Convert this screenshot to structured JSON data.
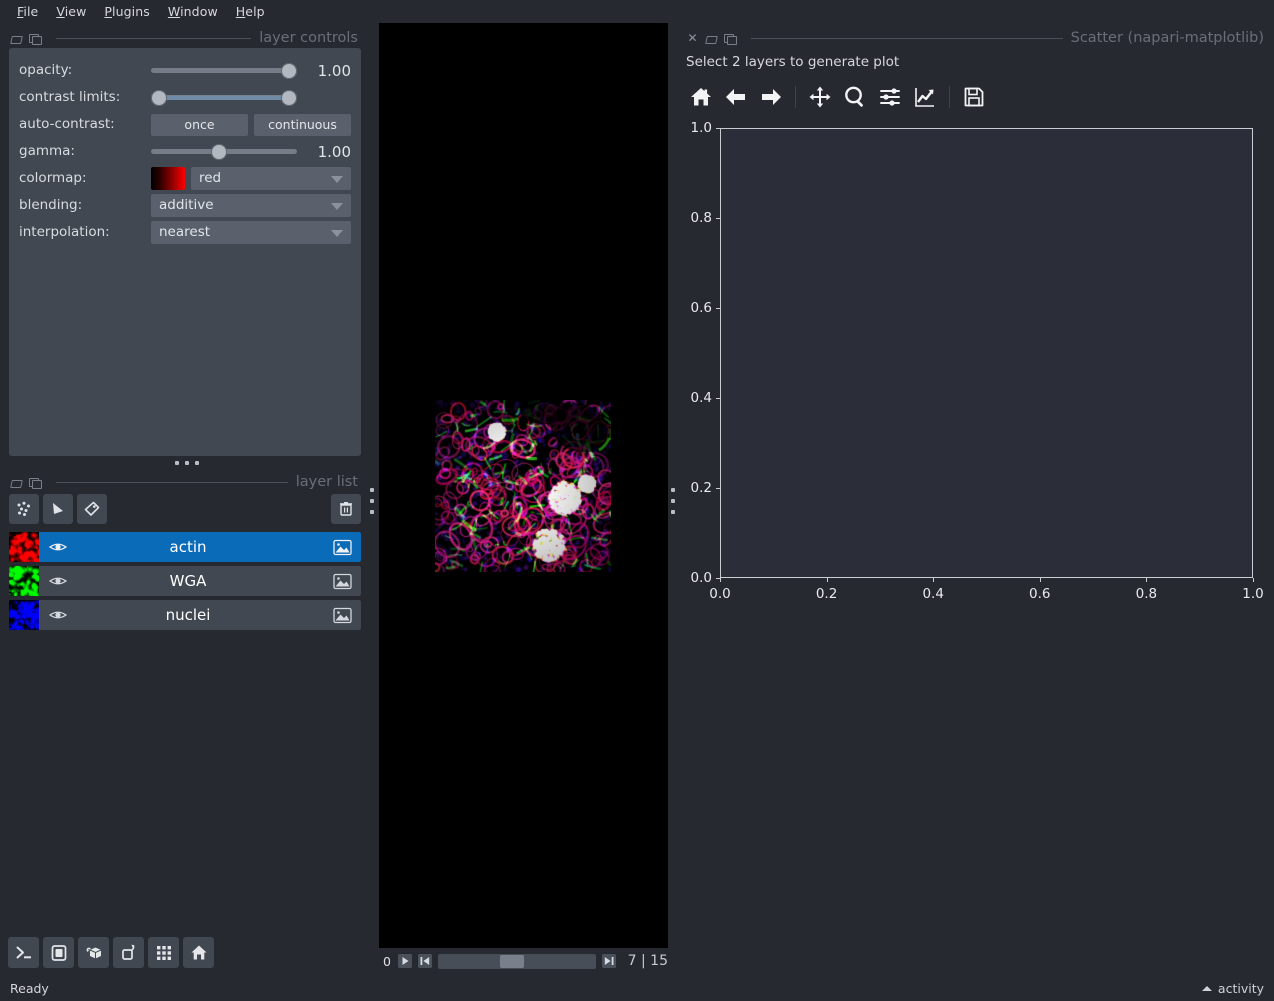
{
  "menubar": {
    "items": [
      {
        "label": "File",
        "mnemonic": "F"
      },
      {
        "label": "View",
        "mnemonic": "V"
      },
      {
        "label": "Plugins",
        "mnemonic": "P"
      },
      {
        "label": "Window",
        "mnemonic": "W"
      },
      {
        "label": "Help",
        "mnemonic": "H"
      }
    ]
  },
  "layer_controls": {
    "title": "layer controls",
    "opacity": {
      "label": "opacity:",
      "value": "1.00",
      "fraction": 1.0
    },
    "contrast_limits": {
      "label": "contrast limits:",
      "low_fraction": 0.0,
      "high_fraction": 1.0
    },
    "auto_contrast": {
      "label": "auto-contrast:",
      "once_label": "once",
      "continuous_label": "continuous"
    },
    "gamma": {
      "label": "gamma:",
      "value": "1.00",
      "fraction": 0.42
    },
    "colormap": {
      "label": "colormap:",
      "value": "red",
      "swatch_color": "#ff0000"
    },
    "blending": {
      "label": "blending:",
      "value": "additive"
    },
    "interpolation": {
      "label": "interpolation:",
      "value": "nearest"
    }
  },
  "layer_list": {
    "title": "layer list",
    "tools": [
      {
        "name": "new-points-layer",
        "tooltip": "New points layer"
      },
      {
        "name": "new-shapes-layer",
        "tooltip": "New shapes layer"
      },
      {
        "name": "new-labels-layer",
        "tooltip": "New labels layer"
      },
      {
        "name": "delete-layer",
        "tooltip": "Delete selected layers"
      }
    ],
    "layers": [
      {
        "name": "actin",
        "selected": true,
        "visible": true,
        "type": "image",
        "thumb_color": "#d01010"
      },
      {
        "name": "WGA",
        "selected": false,
        "visible": true,
        "type": "image",
        "thumb_color": "#10d010"
      },
      {
        "name": "nuclei",
        "selected": false,
        "visible": true,
        "type": "image",
        "thumb_color": "#2020e8"
      }
    ]
  },
  "viewer_buttons": [
    {
      "name": "console-button",
      "label": "Console"
    },
    {
      "name": "ndisplay-button",
      "label": "Toggle 2D/3D"
    },
    {
      "name": "roll-dims-button",
      "label": "Roll dimensions"
    },
    {
      "name": "transpose-dims-button",
      "label": "Transpose dimensions"
    },
    {
      "name": "grid-view-button",
      "label": "Grid view"
    },
    {
      "name": "reset-view-button",
      "label": "Reset view"
    }
  ],
  "dims": {
    "axis_label": "0",
    "play_label": "play",
    "first_label": "first frame",
    "last_label": "last frame",
    "current": "7",
    "separator": "|",
    "total": "15",
    "counter": "7 | 15",
    "handle_fraction": 0.47
  },
  "scatter_panel": {
    "title": "Scatter (napari-matplotlib)",
    "hint": "Select 2 layers to generate plot",
    "toolbar": [
      {
        "name": "home-icon",
        "label": "Reset original view"
      },
      {
        "name": "back-arrow-icon",
        "label": "Back to previous view"
      },
      {
        "name": "forward-arrow-icon",
        "label": "Forward to next view"
      },
      {
        "name": "pan-move-icon",
        "label": "Pan axes with left mouse"
      },
      {
        "name": "zoom-magnifier-icon",
        "label": "Zoom to rectangle"
      },
      {
        "name": "subplot-sliders-icon",
        "label": "Configure subplots"
      },
      {
        "name": "edit-axis-curve-icon",
        "label": "Edit axis, curve and image parameters"
      },
      {
        "name": "save-floppy-icon",
        "label": "Save the figure"
      }
    ]
  },
  "chart_data": {
    "type": "scatter",
    "title": "",
    "xlabel": "",
    "ylabel": "",
    "xlim": [
      0.0,
      1.0
    ],
    "ylim": [
      0.0,
      1.0
    ],
    "xticks": [
      "0.0",
      "0.2",
      "0.4",
      "0.6",
      "0.8",
      "1.0"
    ],
    "yticks": [
      "0.0",
      "0.2",
      "0.4",
      "0.6",
      "0.8",
      "1.0"
    ],
    "xtick_values": [
      0.0,
      0.2,
      0.4,
      0.6,
      0.8,
      1.0
    ],
    "ytick_values": [
      0.0,
      0.2,
      0.4,
      0.6,
      0.8,
      1.0
    ],
    "grid": false,
    "legend": false,
    "series": [],
    "x": [],
    "y": [],
    "note": "Empty axes — no data plotted"
  },
  "status_bar": {
    "status": "Ready",
    "activity_label": "activity"
  },
  "colors": {
    "window_bg": "#262930",
    "panel_bg": "#414851",
    "widget_bg": "#5a616c",
    "selection": "#0a6bb8",
    "text": "#d6d8de",
    "muted_text": "#6a6e78",
    "canvas_bg": "#000000",
    "axes_bg": "#2b2e38"
  }
}
